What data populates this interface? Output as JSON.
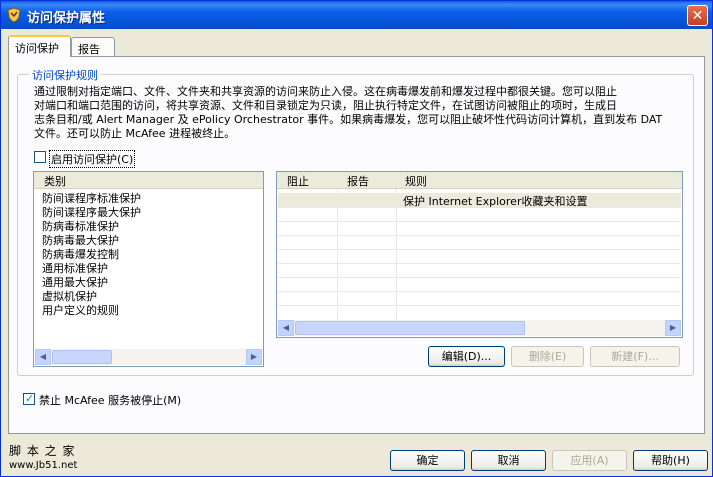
{
  "window": {
    "title": "访问保护属性",
    "close_glyph": "✕"
  },
  "tabs": [
    {
      "label": "访问保护"
    },
    {
      "label": "报告"
    }
  ],
  "group": {
    "legend": "访问保护规则",
    "description": "通过限制对指定端口、文件、文件夹和共享资源的访问来防止入侵。这在病毒爆发前和爆发过程中都很关键。您可以阻止\n对端口和端口范围的访问，将共享资源、文件和目录锁定为只读，阻止执行特定文件，在试图访问被阻止的项时，生成日\n志条目和/或 Alert Manager 及 ePolicy Orchestrator 事件。如果病毒爆发，您可以阻止破坏性代码访问计算机，直到发布 DAT\n文件。还可以防止 McAfee 进程被终止。"
  },
  "enable_checkbox": {
    "label": "启用访问保护(C)",
    "checked": false
  },
  "category_list": {
    "header": "类别",
    "items": [
      "防间谍程序标准保护",
      "防间谍程序最大保护",
      "防病毒标准保护",
      "防病毒最大保护",
      "防病毒爆发控制",
      "通用标准保护",
      "通用最大保护",
      "虚拟机保护",
      "用户定义的规则"
    ]
  },
  "rules_table": {
    "columns": [
      "阻止",
      "报告",
      "规则"
    ],
    "rows": [
      {
        "block": "",
        "report": "",
        "rule": "保护 Internet Explorer收藏夹和设置"
      }
    ]
  },
  "rule_buttons": {
    "edit": "编辑(D)...",
    "delete": "删除(E)",
    "new": "新建(F)..."
  },
  "prevent_checkbox": {
    "label": "禁止 McAfee 服务被停止(M)",
    "checked": true,
    "check_glyph": "✓"
  },
  "footer_buttons": {
    "ok": "确定",
    "cancel": "取消",
    "apply": "应用(A)",
    "help": "帮助(H)"
  },
  "watermark": {
    "line1": "脚 本 之 家",
    "line2": "www.Jb51.net"
  },
  "scroll_glyphs": {
    "left": "◀",
    "right": "▶"
  },
  "colors": {
    "title_bar": "#0a5ee8",
    "legend_text": "#0046d5",
    "selected_row": "#ebeadb"
  }
}
